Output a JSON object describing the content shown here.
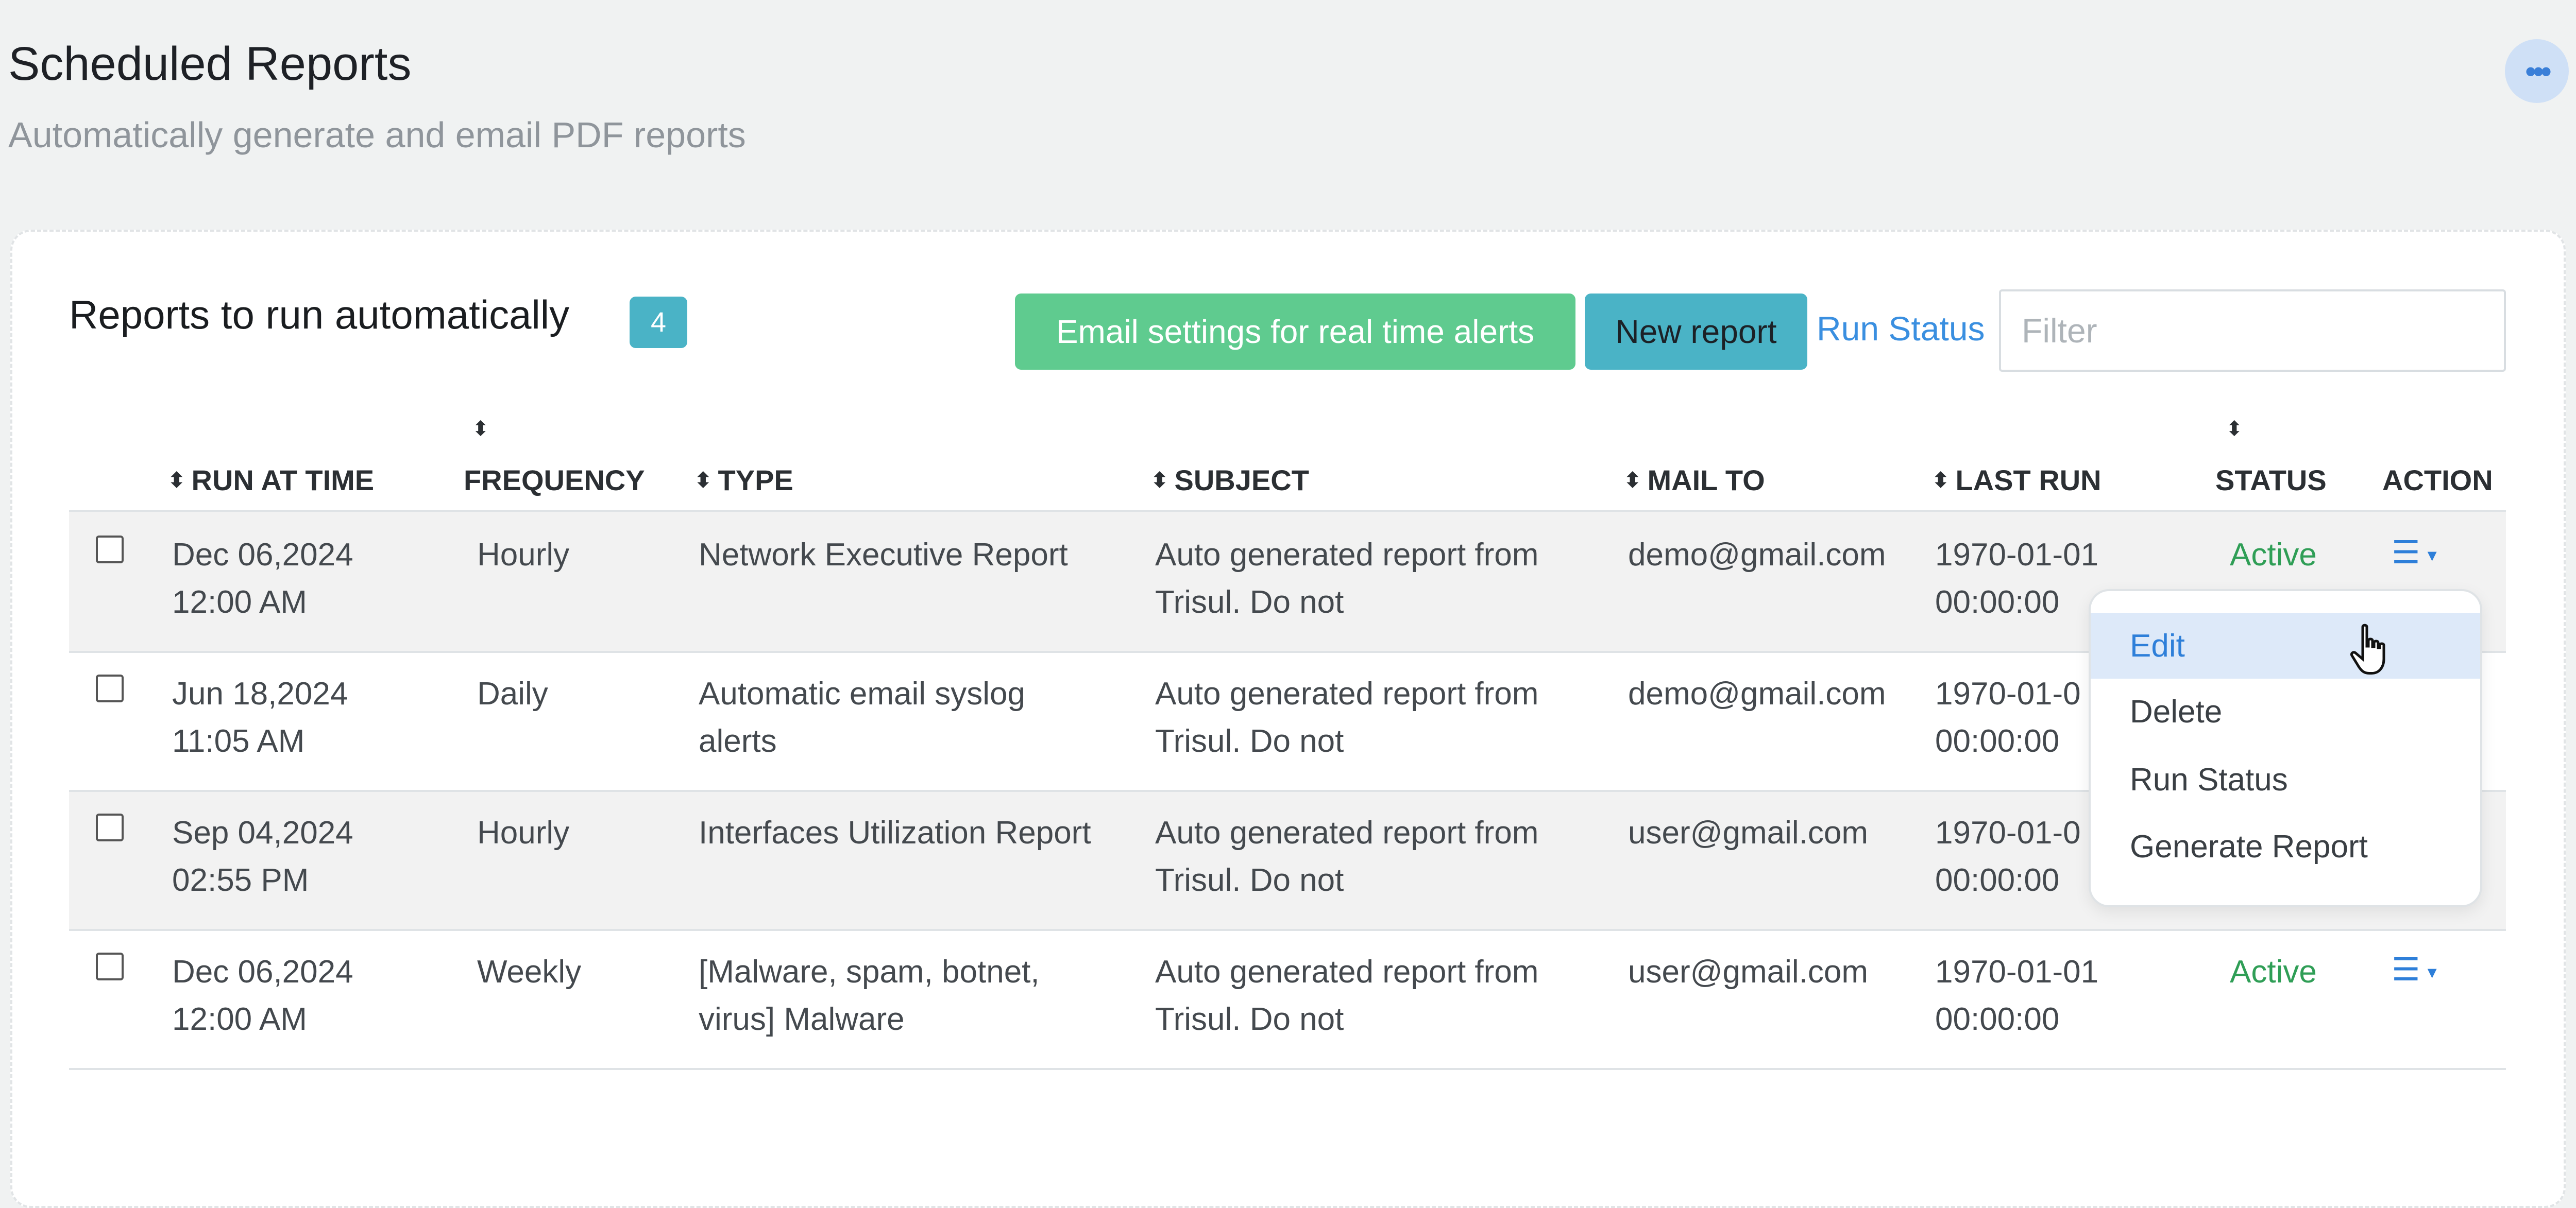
{
  "header": {
    "title": "Scheduled Reports",
    "subtitle": "Automatically generate and email PDF reports",
    "menu_icon": "ellipsis-icon"
  },
  "card": {
    "title": "Reports to run automatically",
    "count": "4",
    "email_settings_label": "Email settings for real time alerts",
    "new_report_label": "New report",
    "run_status_label": "Run Status",
    "filter_placeholder": "Filter"
  },
  "table": {
    "columns": [
      "RUN AT TIME",
      "FREQUENCY",
      "TYPE",
      "SUBJECT",
      "MAIL TO",
      "LAST RUN",
      "STATUS",
      "ACTION"
    ],
    "rows": [
      {
        "run_at_date": "Dec 06,2024",
        "run_at_time": "12:00 AM",
        "frequency": "Hourly",
        "type_line1": "Network Executive Report",
        "type_line2": "",
        "subject_line1": "Auto generated report from",
        "subject_line2": "Trisul. Do not",
        "mail_to": "demo@gmail.com",
        "last_run_date": "1970-01-01",
        "last_run_time": "00:00:00",
        "status": "Active"
      },
      {
        "run_at_date": "Jun 18,2024",
        "run_at_time": "11:05 AM",
        "frequency": "Daily",
        "type_line1": "Automatic email syslog",
        "type_line2": "alerts",
        "subject_line1": "Auto generated report from",
        "subject_line2": "Trisul. Do not",
        "mail_to": "demo@gmail.com",
        "last_run_date": "1970-01-0",
        "last_run_time": "00:00:00",
        "status": ""
      },
      {
        "run_at_date": "Sep 04,2024",
        "run_at_time": "02:55 PM",
        "frequency": "Hourly",
        "type_line1": "Interfaces Utilization Report",
        "type_line2": "",
        "subject_line1": "Auto generated report from",
        "subject_line2": "Trisul. Do not",
        "mail_to": "user@gmail.com",
        "last_run_date": "1970-01-0",
        "last_run_time": "00:00:00",
        "status": ""
      },
      {
        "run_at_date": "Dec 06,2024",
        "run_at_time": "12:00 AM",
        "frequency": "Weekly",
        "type_line1": "[Malware, spam, botnet,",
        "type_line2": "virus] Malware",
        "subject_line1": "Auto generated report from",
        "subject_line2": "Trisul. Do not",
        "mail_to": "user@gmail.com",
        "last_run_date": "1970-01-01",
        "last_run_time": "00:00:00",
        "status": "Active"
      }
    ]
  },
  "dropdown": {
    "items": [
      "Edit",
      "Delete",
      "Run Status",
      "Generate Report"
    ],
    "highlighted": "Edit"
  },
  "colors": {
    "accent_blue": "#2e7fd9",
    "success_green": "#5fcb8f",
    "info_teal": "#4ab3c6",
    "active_status": "#2f9e56"
  }
}
